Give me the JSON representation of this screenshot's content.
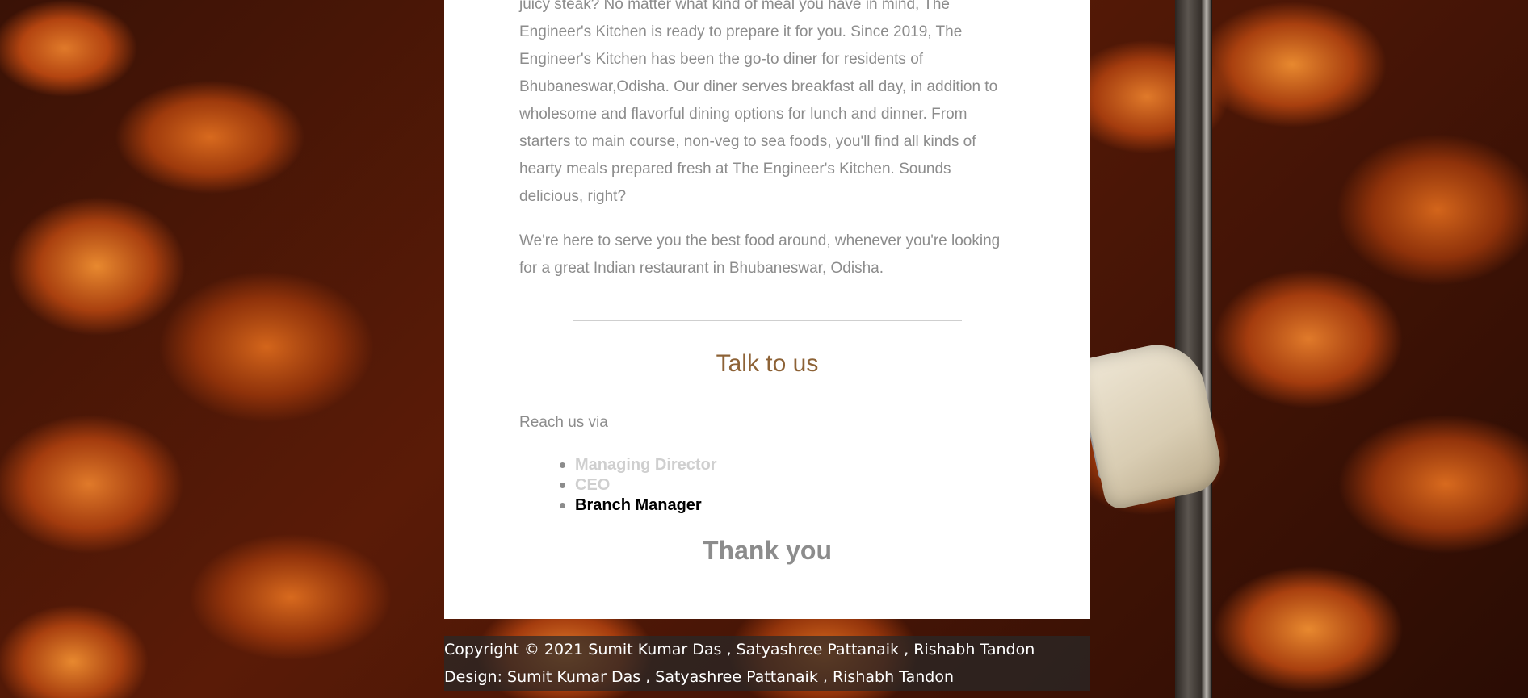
{
  "about": {
    "paragraph1": "juicy steak? No matter what kind of meal you have in mind, The Engineer's Kitchen is ready to prepare it for you. Since 2019, The Engineer's Kitchen has been the go-to diner for residents of Bhubaneswar,Odisha. Our diner serves breakfast all day, in addition to wholesome and flavorful dining options for lunch and dinner. From starters to main course, non-veg to sea foods, you'll find all kinds of hearty meals prepared fresh at The Engineer's Kitchen. Sounds delicious, right?",
    "paragraph2": "We're here to serve you the best food around, whenever you're looking for a great Indian restaurant in Bhubaneswar, Odisha."
  },
  "contact": {
    "title": "Talk to us",
    "reach_label": "Reach us via",
    "options": [
      {
        "label": "Managing Director",
        "active": false
      },
      {
        "label": "CEO",
        "active": false
      },
      {
        "label": "Branch Manager",
        "active": true
      }
    ],
    "thanks": "Thank you"
  },
  "footer": {
    "copyright": "Copyright © 2021 Sumit Kumar Das , Satyashree Pattanaik , Rishabh Tandon",
    "design": "Design: Sumit Kumar Das , Satyashree Pattanaik , Rishabh Tandon"
  },
  "colors": {
    "title_brown": "#8d6236",
    "body_gray": "#8c8c8c",
    "inactive_gray": "#cfcfcf"
  }
}
